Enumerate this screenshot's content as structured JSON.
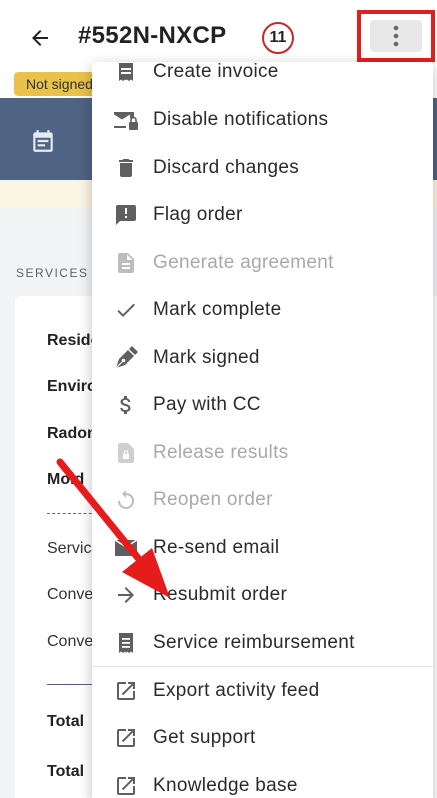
{
  "header": {
    "order_id": "#552N-NXCP",
    "count": "11",
    "status_badge": "Not signed"
  },
  "background": {
    "section_label": "SERVICES",
    "services": [
      "Residential",
      "Environmental",
      "Radon",
      "Mold"
    ],
    "lines": [
      "Service",
      "Convenience",
      "Convenience"
    ],
    "totals": [
      "Total",
      "Total"
    ]
  },
  "menu": {
    "items": [
      {
        "label": "Create invoice",
        "icon": "receipt-icon",
        "disabled": false
      },
      {
        "label": "Disable notifications",
        "icon": "mail-lock-icon",
        "disabled": false
      },
      {
        "label": "Discard changes",
        "icon": "trash-icon",
        "disabled": false
      },
      {
        "label": "Flag order",
        "icon": "flag-message-icon",
        "disabled": false
      },
      {
        "label": "Generate agreement",
        "icon": "document-icon",
        "disabled": true
      },
      {
        "label": "Mark complete",
        "icon": "check-icon",
        "disabled": false
      },
      {
        "label": "Mark signed",
        "icon": "pen-icon",
        "disabled": false
      },
      {
        "label": "Pay with CC",
        "icon": "dollar-icon",
        "disabled": false
      },
      {
        "label": "Release results",
        "icon": "file-lock-icon",
        "disabled": true
      },
      {
        "label": "Reopen order",
        "icon": "refresh-icon",
        "disabled": true
      },
      {
        "label": "Re-send email",
        "icon": "email-icon",
        "disabled": false
      },
      {
        "label": "Resubmit order",
        "icon": "arrow-right-icon",
        "disabled": false
      },
      {
        "label": "Service reimbursement",
        "icon": "receipt-long-icon",
        "disabled": false
      },
      {
        "label": "Export activity feed",
        "icon": "open-in-new-icon",
        "disabled": false
      },
      {
        "label": "Get support",
        "icon": "open-in-new-icon",
        "disabled": false
      },
      {
        "label": "Knowledge base",
        "icon": "open-in-new-icon",
        "disabled": false
      }
    ]
  },
  "colors": {
    "accent_band": "#4f6384",
    "highlight": "#e02020",
    "badge": "#e8c24a"
  }
}
